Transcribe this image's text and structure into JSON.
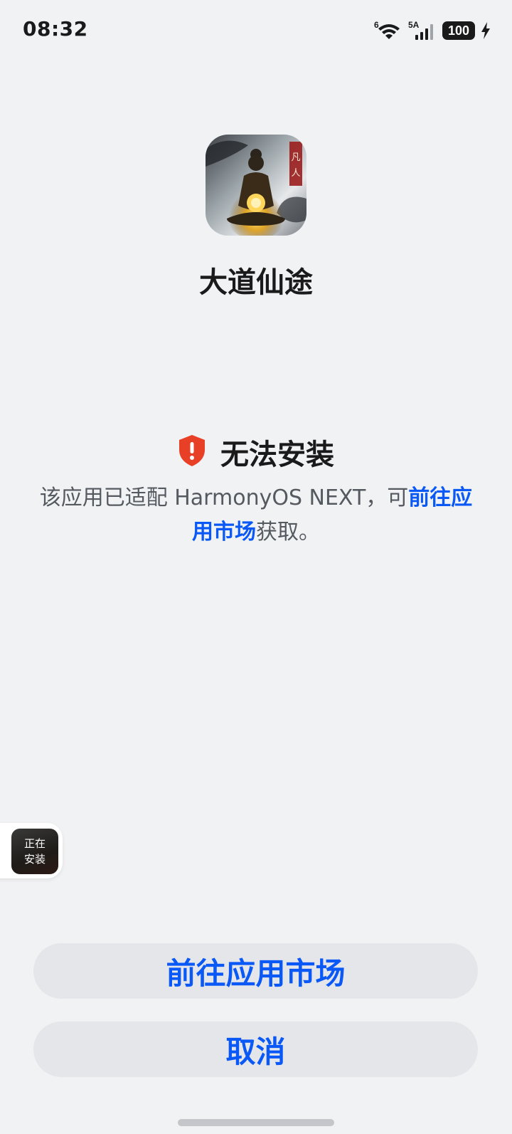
{
  "status_bar": {
    "time": "08:32",
    "wifi_badge": "6",
    "signal_badge": "5A",
    "battery_level": "100",
    "icons": [
      "wifi-icon",
      "cellular-signal-icon",
      "battery-icon",
      "charging-bolt-icon"
    ]
  },
  "app": {
    "name": "大道仙途",
    "icon": "app-icon-meditating-figure",
    "icon_text": "凡人"
  },
  "error": {
    "icon": "shield-alert-icon",
    "title": "无法安装",
    "message_prefix": "该应用已适配 HarmonyOS NEXT，可",
    "message_link": "前往应用市场",
    "message_suffix": "获取。"
  },
  "floating_status": {
    "label": "正在安装"
  },
  "buttons": {
    "go_market": "前往应用市场",
    "cancel": "取消"
  },
  "colors": {
    "background": "#f1f2f4",
    "accent": "#0a59f7",
    "error_red": "#e84026",
    "button_bg": "#e5e6e9"
  }
}
